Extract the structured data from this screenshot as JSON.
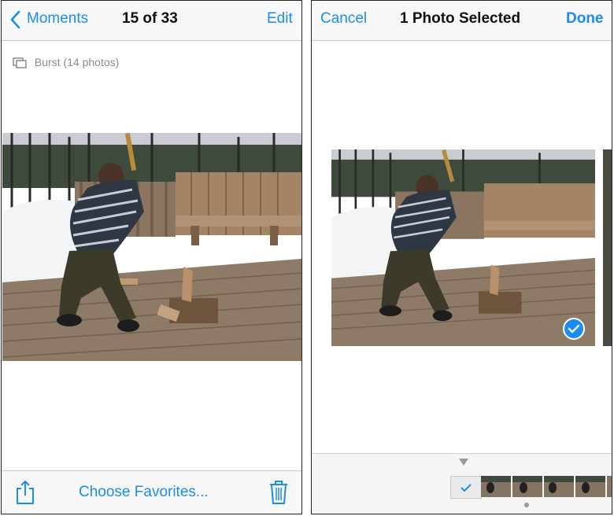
{
  "left": {
    "nav": {
      "back_label": "Moments",
      "title": "15 of 33",
      "edit_label": "Edit"
    },
    "burst_label": "Burst (14 photos)",
    "toolbar": {
      "choose_label": "Choose Favorites..."
    }
  },
  "right": {
    "nav": {
      "cancel_label": "Cancel",
      "title": "1 Photo Selected",
      "done_label": "Done"
    },
    "selected_count": 1
  },
  "icons": {
    "back": "chevron-left-icon",
    "burst": "burst-stack-icon",
    "share": "share-icon",
    "trash": "trash-icon",
    "check": "checkmark-icon"
  },
  "colors": {
    "accent": "#1a8cf0"
  }
}
